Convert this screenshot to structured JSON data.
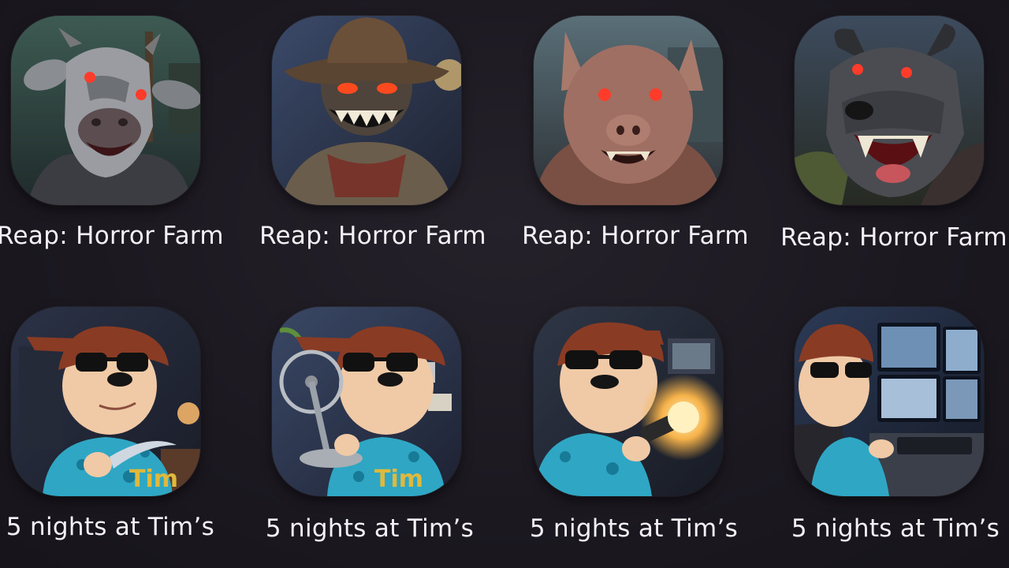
{
  "rows": [
    {
      "apps": [
        {
          "title": "Reap: Horror Farm",
          "icon": "cow-monster-icon"
        },
        {
          "title": "Reap: Horror Farm",
          "icon": "scarecrow-monster-icon"
        },
        {
          "title": "Reap: Horror Farm",
          "icon": "pig-monster-icon"
        },
        {
          "title": "Reap: Horror Farm",
          "icon": "dog-monster-icon"
        }
      ]
    },
    {
      "apps": [
        {
          "title": "5 nights at Tim’s",
          "icon": "tim-knife-icon"
        },
        {
          "title": "5 nights at Tim’s",
          "icon": "tim-fan-icon"
        },
        {
          "title": "5 nights at Tim’s",
          "icon": "tim-flashlight-icon"
        },
        {
          "title": "5 nights at Tim’s",
          "icon": "tim-monitors-icon"
        }
      ]
    }
  ],
  "colors": {
    "background": "#1c1920",
    "label": "#f4f1f6",
    "monster_eyes": "#ff3b2a"
  }
}
